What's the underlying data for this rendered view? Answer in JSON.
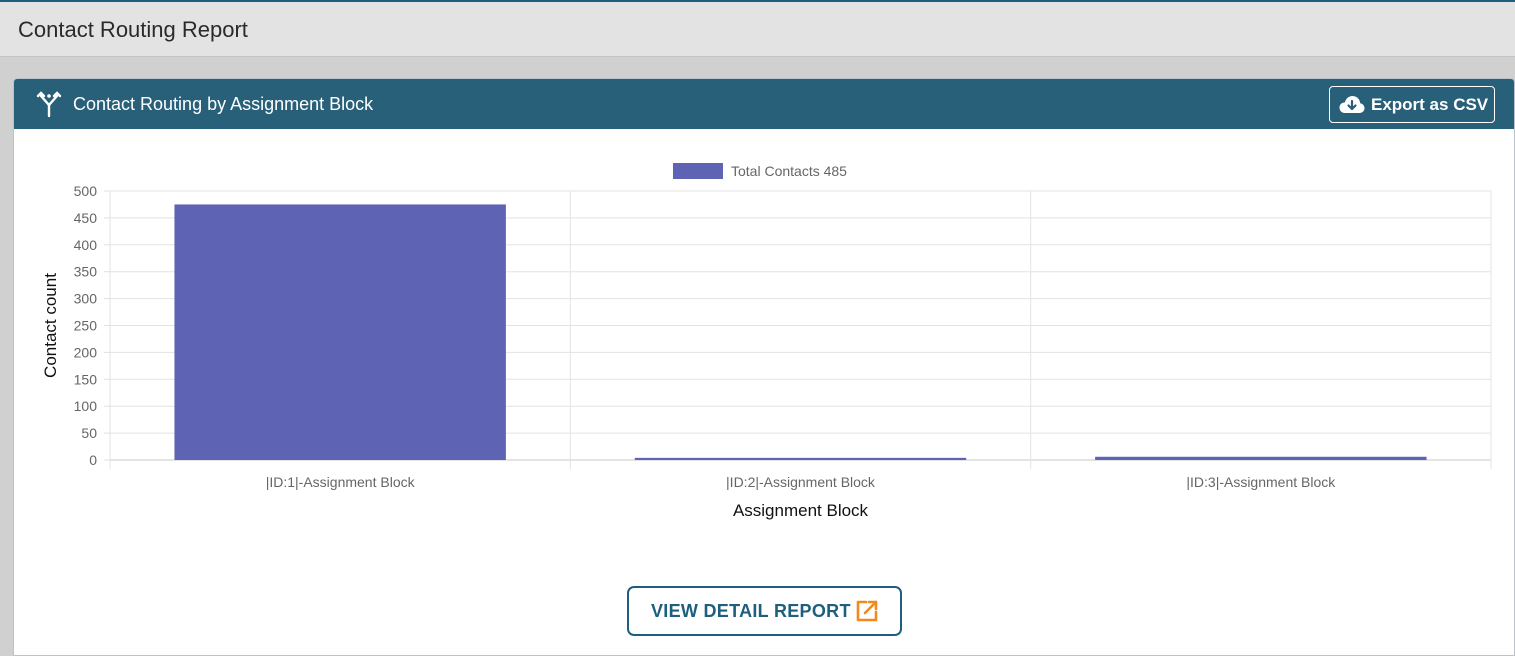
{
  "page": {
    "title": "Contact Routing Report"
  },
  "panel": {
    "title": "Contact Routing by Assignment Block",
    "icon": "routing-fork-icon",
    "export_label": "Export as CSV",
    "export_icon": "cloud-download-icon",
    "detail_label": "VIEW DETAIL REPORT",
    "detail_icon": "external-link-icon"
  },
  "colors": {
    "header_bg": "#285f79",
    "bar": "#5e63b4",
    "accent": "#1e5f7e",
    "external_link_icon": "#f08a1c"
  },
  "chart_data": {
    "type": "bar",
    "categories": [
      "|ID:1|-Assignment Block",
      "|ID:2|-Assignment Block",
      "|ID:3|-Assignment Block"
    ],
    "series": [
      {
        "name": "Total Contacts 485",
        "values": [
          475,
          4,
          6
        ]
      }
    ],
    "xlabel": "Assignment Block",
    "ylabel": "Contact count",
    "ylim": [
      0,
      500
    ],
    "yticks": [
      0,
      50,
      100,
      150,
      200,
      250,
      300,
      350,
      400,
      450,
      500
    ],
    "grid": true,
    "legend": "top-center"
  }
}
